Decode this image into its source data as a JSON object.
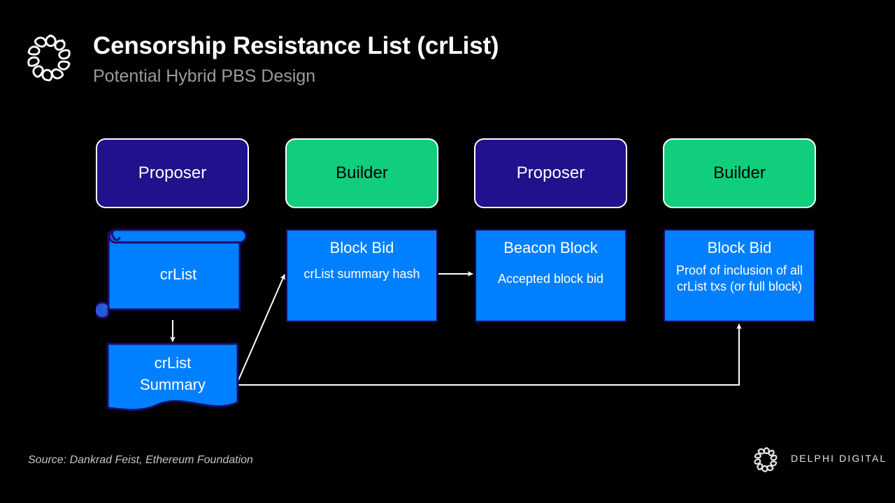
{
  "header": {
    "title": "Censorship Resistance List (crList)",
    "subtitle": "Potential Hybrid PBS Design",
    "logo_icon": "delphi-knot-logo-icon"
  },
  "colors": {
    "background": "#000000",
    "proposer_fill": "#20118C",
    "builder_fill": "#10CE7C",
    "data_fill": "#0080FF",
    "data_stroke": "#1C0B66",
    "arrow": "#FFFFFF",
    "title_text": "#FFFFFF",
    "subtitle_text": "#9B9B9B",
    "source_text": "#C5C5C5"
  },
  "diagram": {
    "roles": [
      {
        "label": "Proposer",
        "kind": "proposer"
      },
      {
        "label": "Builder",
        "kind": "builder"
      },
      {
        "label": "Proposer",
        "kind": "proposer"
      },
      {
        "label": "Builder",
        "kind": "builder"
      }
    ],
    "crlist": {
      "label": "crList",
      "shape": "scroll"
    },
    "crlist_summary": {
      "line1": "crList",
      "line2": "Summary",
      "shape": "document"
    },
    "blocks": [
      {
        "title": "Block Bid",
        "body": "crList summary hash"
      },
      {
        "title": "Beacon Block",
        "body": "Accepted block bid"
      },
      {
        "title": "Block Bid",
        "body": "Proof of inclusion of all crList txs (or full block)"
      }
    ],
    "connectors": [
      {
        "name": "crlist-to-summary",
        "style": "straight-down"
      },
      {
        "name": "summary-to-block-bid",
        "style": "diagonal-up-right"
      },
      {
        "name": "block-bid-to-beacon-block",
        "style": "straight-right"
      },
      {
        "name": "summary-to-final-block-bid",
        "style": "elbow-right-up"
      }
    ]
  },
  "footer": {
    "source": "Source: Dankrad Feist, Ethereum Foundation",
    "wordmark": "DELPHI DIGITAL",
    "logo_icon": "delphi-knot-logo-icon"
  }
}
